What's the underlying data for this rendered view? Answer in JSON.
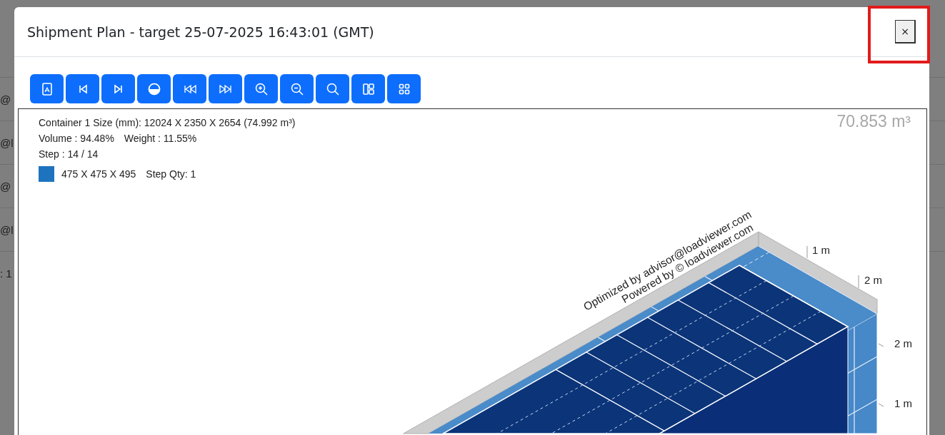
{
  "window": {
    "title": "Shipment Plan - target 25-07-2025 16:43:01 (GMT)"
  },
  "close_button": {
    "label": "×",
    "highlighted": true
  },
  "background_rows": [
    {
      "text": "@"
    },
    {
      "text": "@l"
    },
    {
      "text": "@"
    },
    {
      "text": "@l"
    },
    {
      "text": ": 1"
    }
  ],
  "toolbar": [
    {
      "kind": "document"
    },
    {
      "kind": "skip-back"
    },
    {
      "kind": "skip-forward"
    },
    {
      "kind": "half-circle"
    },
    {
      "kind": "rewind"
    },
    {
      "kind": "fast-forward"
    },
    {
      "kind": "zoom-in"
    },
    {
      "kind": "zoom-out"
    },
    {
      "kind": "search"
    },
    {
      "kind": "layout"
    },
    {
      "kind": "grid"
    }
  ],
  "viewer": {
    "volume": "70.853 m³",
    "size_line": "Container 1 Size (mm): 12024 X 2350 X 2654 (74.992 m³)",
    "volume_line": "Volume : 94.48%",
    "weight_line": "Weight : 11.55%",
    "step_line": "Step : 14 / 14",
    "legend": [
      {
        "color": "#1e73be",
        "dims": "475 X 475 X 495",
        "qty": "Step Qty: 1"
      }
    ],
    "credits": [
      "Optimized by advisor@loadviewer.com",
      "Powered by © loadviewer.com"
    ],
    "axis_labels": [
      "1 m",
      "2 m",
      "2 m",
      "1 m"
    ]
  }
}
